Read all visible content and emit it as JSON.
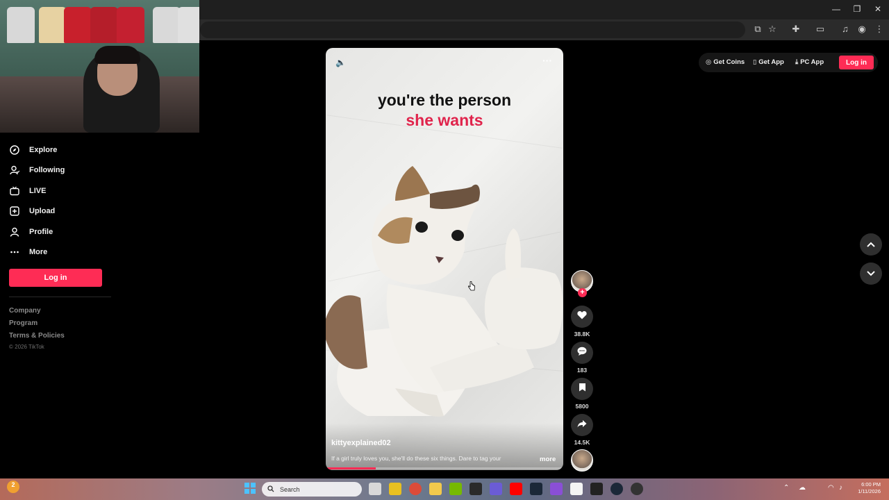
{
  "window": {
    "minimize_icon": "minimize-icon",
    "restore_icon": "restore-icon",
    "close_icon": "close-icon"
  },
  "sidebar": {
    "items": [
      {
        "label": "Explore",
        "icon": "compass-icon"
      },
      {
        "label": "Following",
        "icon": "following-icon"
      },
      {
        "label": "LIVE",
        "icon": "live-tv-icon"
      },
      {
        "label": "Upload",
        "icon": "upload-plus-icon"
      },
      {
        "label": "Profile",
        "icon": "profile-icon"
      },
      {
        "label": "More",
        "icon": "more-dots-icon"
      }
    ],
    "login_label": "Log in",
    "footer_links": [
      "Company",
      "Program",
      "Terms & Policies"
    ],
    "copyright": "© 2026 TikTok"
  },
  "video": {
    "title_line1": "you're the person",
    "title_line2": "she wants",
    "author": "kittyexplained02",
    "caption": "If a girl truly loves you, she'll do these six things. Dare to tag your",
    "more_label": "more",
    "progress": 0.21,
    "accent": "#fe2c55"
  },
  "actions": {
    "likes": "38.8K",
    "comments": "183",
    "saves": "5800",
    "shares": "14.5K"
  },
  "topbar": {
    "get_coins": "Get Coins",
    "get_app": "Get App",
    "pc_app": "PC App",
    "login_label": "Log in"
  },
  "taskbar": {
    "search_placeholder": "Search",
    "notification_count": "2",
    "clock_time": "6:00 PM",
    "clock_date": "1/11/2026"
  }
}
